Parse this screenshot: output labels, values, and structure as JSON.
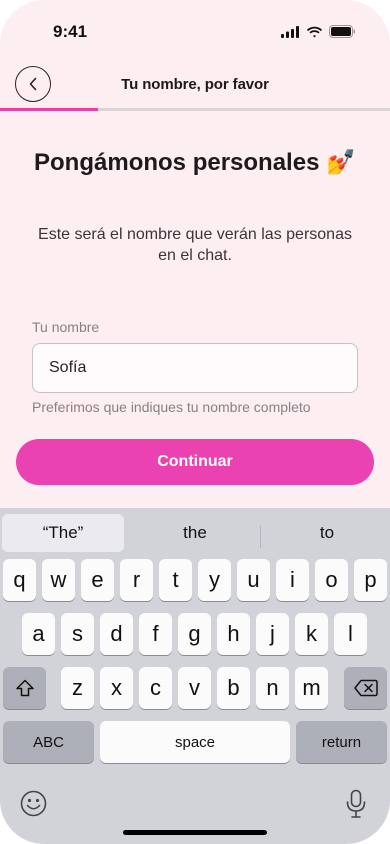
{
  "status_bar": {
    "time": "9:41"
  },
  "header": {
    "title": "Tu nombre, por favor",
    "progress": 0.25
  },
  "main": {
    "heading": "Pongámonos personales",
    "heading_emoji": "💅",
    "subtitle": "Este será el nombre que verán las personas en el chat.",
    "field_label": "Tu nombre",
    "field_value": "Sofía",
    "hint": "Preferimos que indiques tu nombre completo",
    "cta_label": "Continuar"
  },
  "keyboard": {
    "suggestions": [
      "“The”",
      "the",
      "to"
    ],
    "row1": [
      "q",
      "w",
      "e",
      "r",
      "t",
      "y",
      "u",
      "i",
      "o",
      "p"
    ],
    "row2": [
      "a",
      "s",
      "d",
      "f",
      "g",
      "h",
      "j",
      "k",
      "l"
    ],
    "row3": [
      "z",
      "x",
      "c",
      "v",
      "b",
      "n",
      "m"
    ],
    "abc_label": "ABC",
    "space_label": "space",
    "return_label": "return"
  },
  "colors": {
    "accent": "#ea42b0",
    "background": "#fdeef2",
    "keyboard": "#d2d3d9"
  }
}
